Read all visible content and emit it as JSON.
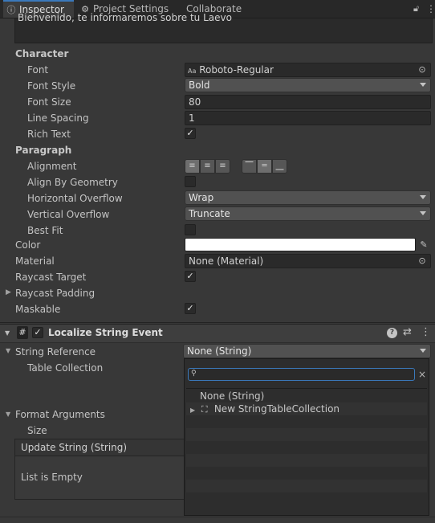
{
  "tabs": [
    {
      "label": "Inspector",
      "icon": "info-icon",
      "active": true
    },
    {
      "label": "Project Settings",
      "icon": "gear-icon",
      "active": false
    },
    {
      "label": "Collaborate",
      "icon": "",
      "active": false
    }
  ],
  "text_preview": "Bienvenido, te informaremos sobre tu Laevo",
  "character": {
    "heading": "Character",
    "font_label": "Font",
    "font_value": "Roboto-Regular",
    "font_prefix": "Aa",
    "font_style_label": "Font Style",
    "font_style_value": "Bold",
    "font_size_label": "Font Size",
    "font_size_value": "80",
    "line_spacing_label": "Line Spacing",
    "line_spacing_value": "1",
    "rich_text_label": "Rich Text"
  },
  "paragraph": {
    "heading": "Paragraph",
    "alignment_label": "Alignment",
    "align_by_geometry_label": "Align By Geometry",
    "h_overflow_label": "Horizontal Overflow",
    "h_overflow_value": "Wrap",
    "v_overflow_label": "Vertical Overflow",
    "v_overflow_value": "Truncate",
    "best_fit_label": "Best Fit"
  },
  "color_label": "Color",
  "color_value": "#ffffff",
  "material_label": "Material",
  "material_value": "None (Material)",
  "raycast_target_label": "Raycast Target",
  "raycast_padding_label": "Raycast Padding",
  "maskable_label": "Maskable",
  "component": {
    "title": "Localize String Event",
    "string_reference_label": "String Reference",
    "string_reference_value": "None (String)",
    "table_collection_label": "Table Collection",
    "format_arguments_label": "Format Arguments",
    "size_label": "Size",
    "update_string_label": "Update String (String)",
    "list_empty": "List is Empty"
  },
  "popup": {
    "search_value": "",
    "clear_label": "×",
    "items": [
      "None (String)",
      "New StringTableCollection"
    ]
  },
  "colors": {
    "accent": "#3a79bb",
    "background": "#383838",
    "field": "#2a2a2a"
  }
}
